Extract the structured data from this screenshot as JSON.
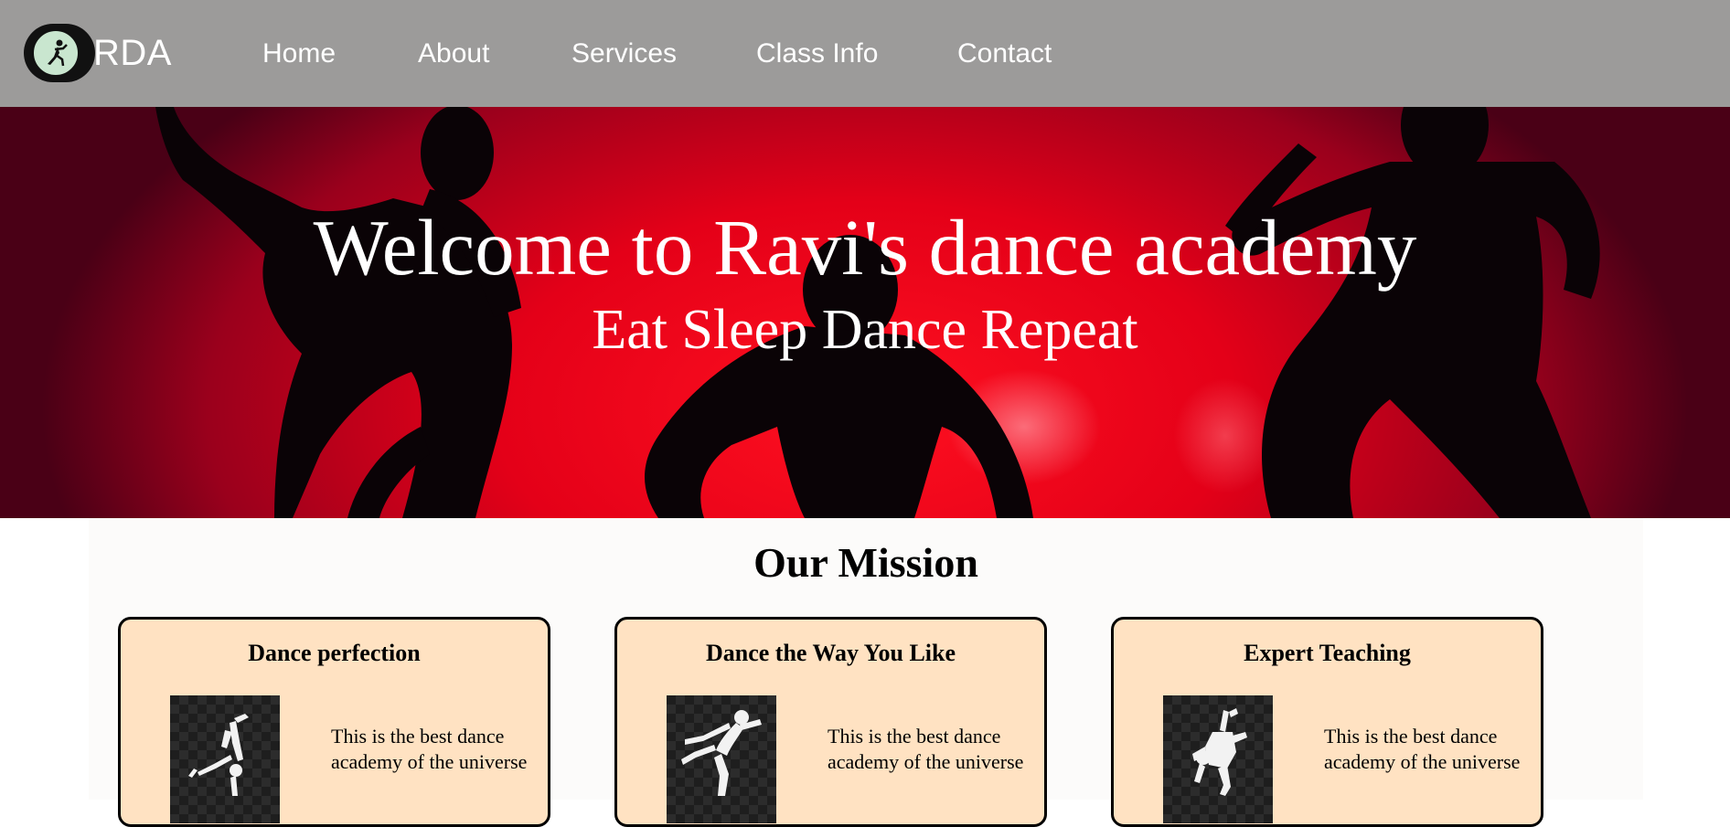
{
  "nav": {
    "logo_text": "RDA",
    "links": [
      "Home",
      "About",
      "Services",
      "Class Info",
      "Contact"
    ]
  },
  "hero": {
    "title": "Welcome to Ravi's dance academy",
    "subtitle": "Eat Sleep Dance Repeat"
  },
  "mission": {
    "heading": "Our Mission",
    "cards": [
      {
        "title": "Dance perfection",
        "text": "This is the best dance academy of the universe",
        "icon": "breakdancer-icon"
      },
      {
        "title": "Dance the Way You Like",
        "text": "This is the best dance academy of the universe",
        "icon": "leaping-dancer-icon"
      },
      {
        "title": "Expert Teaching",
        "text": "This is the best dance academy of the universe",
        "icon": "freeze-pose-dancer-icon"
      }
    ]
  },
  "colors": {
    "nav_bg": "#9c9b9a",
    "hero_red": "#e40018",
    "card_bg": "#ffe2c2",
    "logo_circle": "#c9e6cf"
  }
}
